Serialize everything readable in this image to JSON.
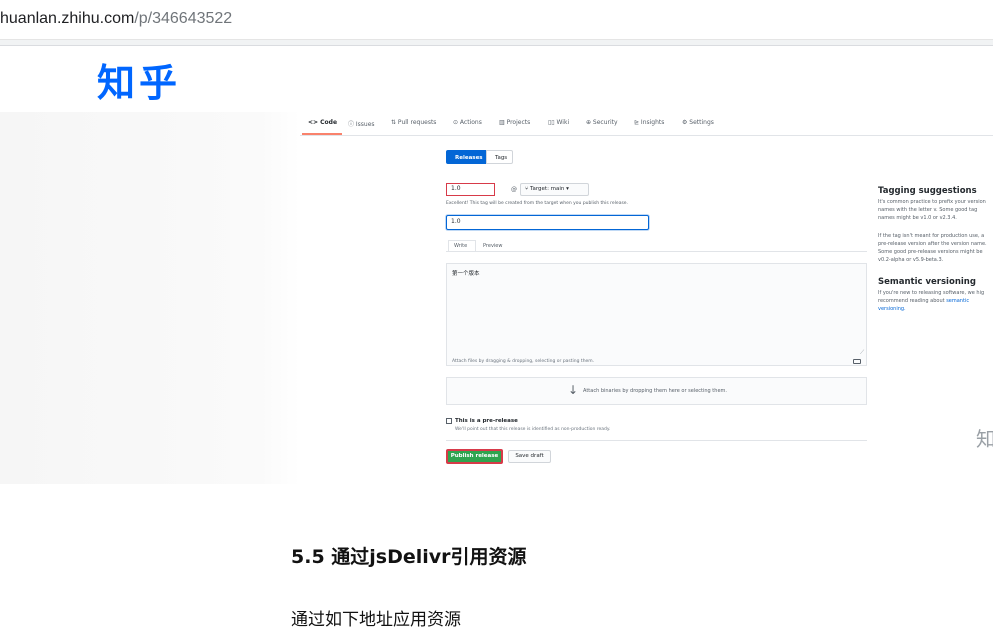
{
  "browser": {
    "url_host": "huanlan.zhihu.com",
    "url_path": "/p/346643522"
  },
  "site": {
    "logo": "知乎"
  },
  "screenshot": {
    "repo_tabs": [
      {
        "label": "<> Code",
        "icon": "code-icon",
        "active": true
      },
      {
        "label": "ⓘ Issues",
        "icon": "issues-icon",
        "active": false
      },
      {
        "label": "⇅ Pull requests",
        "icon": "pull-request-icon",
        "active": false
      },
      {
        "label": "⊙ Actions",
        "icon": "actions-icon",
        "active": false
      },
      {
        "label": "▥ Projects",
        "icon": "projects-icon",
        "active": false
      },
      {
        "label": "▯▯ Wiki",
        "icon": "wiki-icon",
        "active": false
      },
      {
        "label": "⊕ Security",
        "icon": "security-icon",
        "active": false
      },
      {
        "label": "⊵ Insights",
        "icon": "insights-icon",
        "active": false
      },
      {
        "label": "⚙ Settings",
        "icon": "settings-icon",
        "active": false
      }
    ],
    "segmented": {
      "releases": "Releases",
      "tags": "Tags"
    },
    "tag_input_value": "1.0",
    "at_sign": "@",
    "target_label": "⑂ Target: main ▾",
    "tag_hint": "Excellent! This tag will be created from the target when you publish this release.",
    "title_input_value": "1.0",
    "editor_tabs": {
      "write": "Write",
      "preview": "Preview"
    },
    "description": "第一个版本",
    "attach_hint": "Attach files by dragging & dropping, selecting or pasting them.",
    "binaries_hint": "Attach binaries by dropping them here or selecting them.",
    "prerelease_label": "This is a pre-release",
    "prerelease_note": "We'll point out that this release is identified as non-production ready.",
    "publish_label": "Publish release",
    "draft_label": "Save draft",
    "sidebar": {
      "tagging_title": "Tagging suggestions",
      "tagging_lines": [
        "It's common practice to prefix your version",
        "names with the letter v. Some good tag",
        "names might be v1.0 or v2.3.4."
      ],
      "tagging_lines2": [
        "If the tag isn't meant for production use, a",
        "pre-release version after the version name.",
        "Some good pre-release versions might be",
        "v0.2-alpha or v5.9-beta.3."
      ],
      "semver_title": "Semantic versioning",
      "semver_lines": [
        "If you're new to releasing software, we hig",
        "recommend reading about "
      ],
      "semver_link1": "semantic",
      "semver_link2": "versioning."
    },
    "watermark": "知"
  },
  "article": {
    "section_title": "5.5 通过jsDelivr引用资源",
    "body": "通过如下地址应用资源"
  }
}
